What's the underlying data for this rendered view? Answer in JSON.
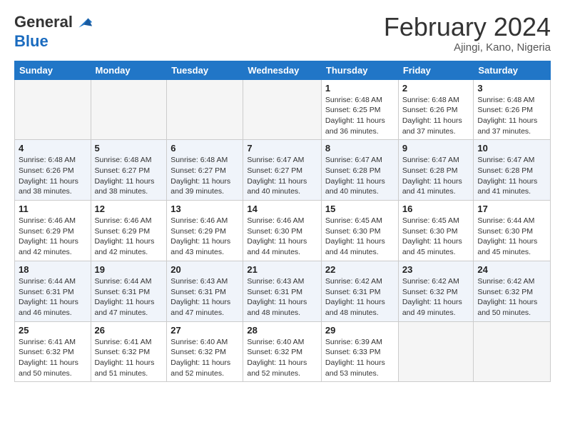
{
  "header": {
    "logo_line1": "General",
    "logo_line2": "Blue",
    "month_title": "February 2024",
    "location": "Ajingi, Kano, Nigeria"
  },
  "weekdays": [
    "Sunday",
    "Monday",
    "Tuesday",
    "Wednesday",
    "Thursday",
    "Friday",
    "Saturday"
  ],
  "weeks": [
    [
      {
        "day": "",
        "info": ""
      },
      {
        "day": "",
        "info": ""
      },
      {
        "day": "",
        "info": ""
      },
      {
        "day": "",
        "info": ""
      },
      {
        "day": "1",
        "info": "Sunrise: 6:48 AM\nSunset: 6:25 PM\nDaylight: 11 hours and 36 minutes."
      },
      {
        "day": "2",
        "info": "Sunrise: 6:48 AM\nSunset: 6:26 PM\nDaylight: 11 hours and 37 minutes."
      },
      {
        "day": "3",
        "info": "Sunrise: 6:48 AM\nSunset: 6:26 PM\nDaylight: 11 hours and 37 minutes."
      }
    ],
    [
      {
        "day": "4",
        "info": "Sunrise: 6:48 AM\nSunset: 6:26 PM\nDaylight: 11 hours and 38 minutes."
      },
      {
        "day": "5",
        "info": "Sunrise: 6:48 AM\nSunset: 6:27 PM\nDaylight: 11 hours and 38 minutes."
      },
      {
        "day": "6",
        "info": "Sunrise: 6:48 AM\nSunset: 6:27 PM\nDaylight: 11 hours and 39 minutes."
      },
      {
        "day": "7",
        "info": "Sunrise: 6:47 AM\nSunset: 6:27 PM\nDaylight: 11 hours and 40 minutes."
      },
      {
        "day": "8",
        "info": "Sunrise: 6:47 AM\nSunset: 6:28 PM\nDaylight: 11 hours and 40 minutes."
      },
      {
        "day": "9",
        "info": "Sunrise: 6:47 AM\nSunset: 6:28 PM\nDaylight: 11 hours and 41 minutes."
      },
      {
        "day": "10",
        "info": "Sunrise: 6:47 AM\nSunset: 6:28 PM\nDaylight: 11 hours and 41 minutes."
      }
    ],
    [
      {
        "day": "11",
        "info": "Sunrise: 6:46 AM\nSunset: 6:29 PM\nDaylight: 11 hours and 42 minutes."
      },
      {
        "day": "12",
        "info": "Sunrise: 6:46 AM\nSunset: 6:29 PM\nDaylight: 11 hours and 42 minutes."
      },
      {
        "day": "13",
        "info": "Sunrise: 6:46 AM\nSunset: 6:29 PM\nDaylight: 11 hours and 43 minutes."
      },
      {
        "day": "14",
        "info": "Sunrise: 6:46 AM\nSunset: 6:30 PM\nDaylight: 11 hours and 44 minutes."
      },
      {
        "day": "15",
        "info": "Sunrise: 6:45 AM\nSunset: 6:30 PM\nDaylight: 11 hours and 44 minutes."
      },
      {
        "day": "16",
        "info": "Sunrise: 6:45 AM\nSunset: 6:30 PM\nDaylight: 11 hours and 45 minutes."
      },
      {
        "day": "17",
        "info": "Sunrise: 6:44 AM\nSunset: 6:30 PM\nDaylight: 11 hours and 45 minutes."
      }
    ],
    [
      {
        "day": "18",
        "info": "Sunrise: 6:44 AM\nSunset: 6:31 PM\nDaylight: 11 hours and 46 minutes."
      },
      {
        "day": "19",
        "info": "Sunrise: 6:44 AM\nSunset: 6:31 PM\nDaylight: 11 hours and 47 minutes."
      },
      {
        "day": "20",
        "info": "Sunrise: 6:43 AM\nSunset: 6:31 PM\nDaylight: 11 hours and 47 minutes."
      },
      {
        "day": "21",
        "info": "Sunrise: 6:43 AM\nSunset: 6:31 PM\nDaylight: 11 hours and 48 minutes."
      },
      {
        "day": "22",
        "info": "Sunrise: 6:42 AM\nSunset: 6:31 PM\nDaylight: 11 hours and 48 minutes."
      },
      {
        "day": "23",
        "info": "Sunrise: 6:42 AM\nSunset: 6:32 PM\nDaylight: 11 hours and 49 minutes."
      },
      {
        "day": "24",
        "info": "Sunrise: 6:42 AM\nSunset: 6:32 PM\nDaylight: 11 hours and 50 minutes."
      }
    ],
    [
      {
        "day": "25",
        "info": "Sunrise: 6:41 AM\nSunset: 6:32 PM\nDaylight: 11 hours and 50 minutes."
      },
      {
        "day": "26",
        "info": "Sunrise: 6:41 AM\nSunset: 6:32 PM\nDaylight: 11 hours and 51 minutes."
      },
      {
        "day": "27",
        "info": "Sunrise: 6:40 AM\nSunset: 6:32 PM\nDaylight: 11 hours and 52 minutes."
      },
      {
        "day": "28",
        "info": "Sunrise: 6:40 AM\nSunset: 6:32 PM\nDaylight: 11 hours and 52 minutes."
      },
      {
        "day": "29",
        "info": "Sunrise: 6:39 AM\nSunset: 6:33 PM\nDaylight: 11 hours and 53 minutes."
      },
      {
        "day": "",
        "info": ""
      },
      {
        "day": "",
        "info": ""
      }
    ]
  ]
}
